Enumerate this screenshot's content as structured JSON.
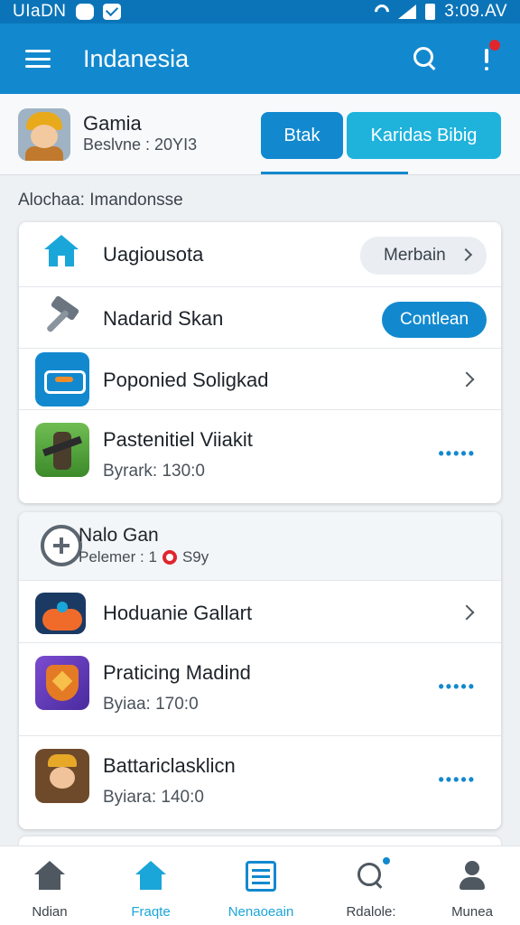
{
  "status_bar": {
    "left_text": "UIaDN",
    "time": "3:09.AV"
  },
  "app_bar": {
    "title": "Indanesia"
  },
  "profile": {
    "name": "Gamia",
    "subtitle": "Beslvne : 20YI3",
    "primary_button": "Btak",
    "secondary_button": "Karidas Bibig"
  },
  "section_label": "Alochaa: Imandonsse",
  "card1": {
    "rows": [
      {
        "title": "Uagiousota",
        "action": "Merbain",
        "icon": "home-icon"
      },
      {
        "title": "Nadarid Skan",
        "action": "Contlean",
        "icon": "hammer-icon"
      },
      {
        "title": "Poponied Soligkad",
        "icon": "toolbox-icon"
      },
      {
        "title": "Pastenitiel Viiakit",
        "subtitle": "Byrark: 130:0",
        "icon": "soldier-game-icon"
      }
    ]
  },
  "card2": {
    "header": {
      "title": "Nalo Gan",
      "subtitle_prefix": "Pelemer : 1",
      "subtitle_suffix": "S9y"
    },
    "rows": [
      {
        "title": "Hoduanie Gallart",
        "icon": "gamepad-icon"
      },
      {
        "title": "Praticing Madind",
        "subtitle": "Byiaa: 170:0",
        "icon": "shield-game-icon"
      },
      {
        "title": "Battariclasklicn",
        "subtitle": "Byiara: 140:0",
        "icon": "knight-game-icon"
      }
    ]
  },
  "more_dots": "•••••",
  "bottom_nav": [
    {
      "label": "Ndian",
      "icon": "home-icon"
    },
    {
      "label": "Fraqte",
      "icon": "home-icon"
    },
    {
      "label": "Nenaoeain",
      "icon": "list-icon"
    },
    {
      "label": "Rdalole:",
      "icon": "search-icon"
    },
    {
      "label": "Munea",
      "icon": "person-icon"
    }
  ],
  "colors": {
    "primary": "#1289cf",
    "accent": "#1fb3dc",
    "alert": "#e0252d"
  }
}
